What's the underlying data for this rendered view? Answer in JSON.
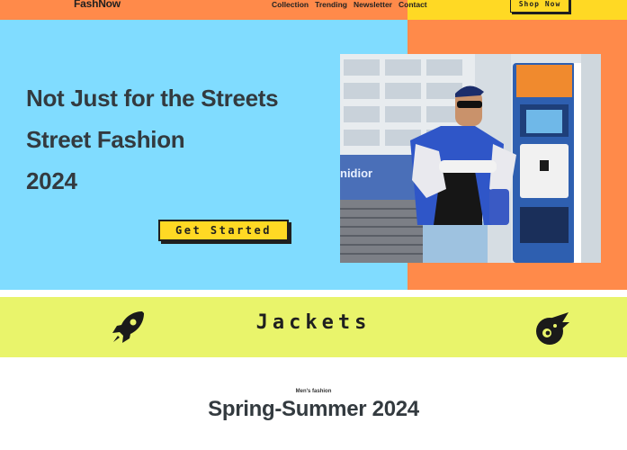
{
  "nav": {
    "brand": "FashNow",
    "links": [
      "Collection",
      "Trending",
      "Newsletter",
      "Contact"
    ],
    "shop_label": "Shop Now"
  },
  "hero": {
    "headline_lines": [
      "Not Just for the Streets",
      "Street Fashion",
      "2024"
    ],
    "cta_label": "Get Started",
    "photo_sign_text": "nidior"
  },
  "category": {
    "title": "Jackets",
    "left_icon": "rocket-icon",
    "right_icon": "meteor-icon"
  },
  "section": {
    "kicker": "Men's fashion",
    "title": "Spring-Summer 2024"
  },
  "colors": {
    "orange": "#ff8a4a",
    "yellow": "#ffd924",
    "sky": "#80dcff",
    "lime": "#e9f46b",
    "ink": "#1f1f1f"
  }
}
